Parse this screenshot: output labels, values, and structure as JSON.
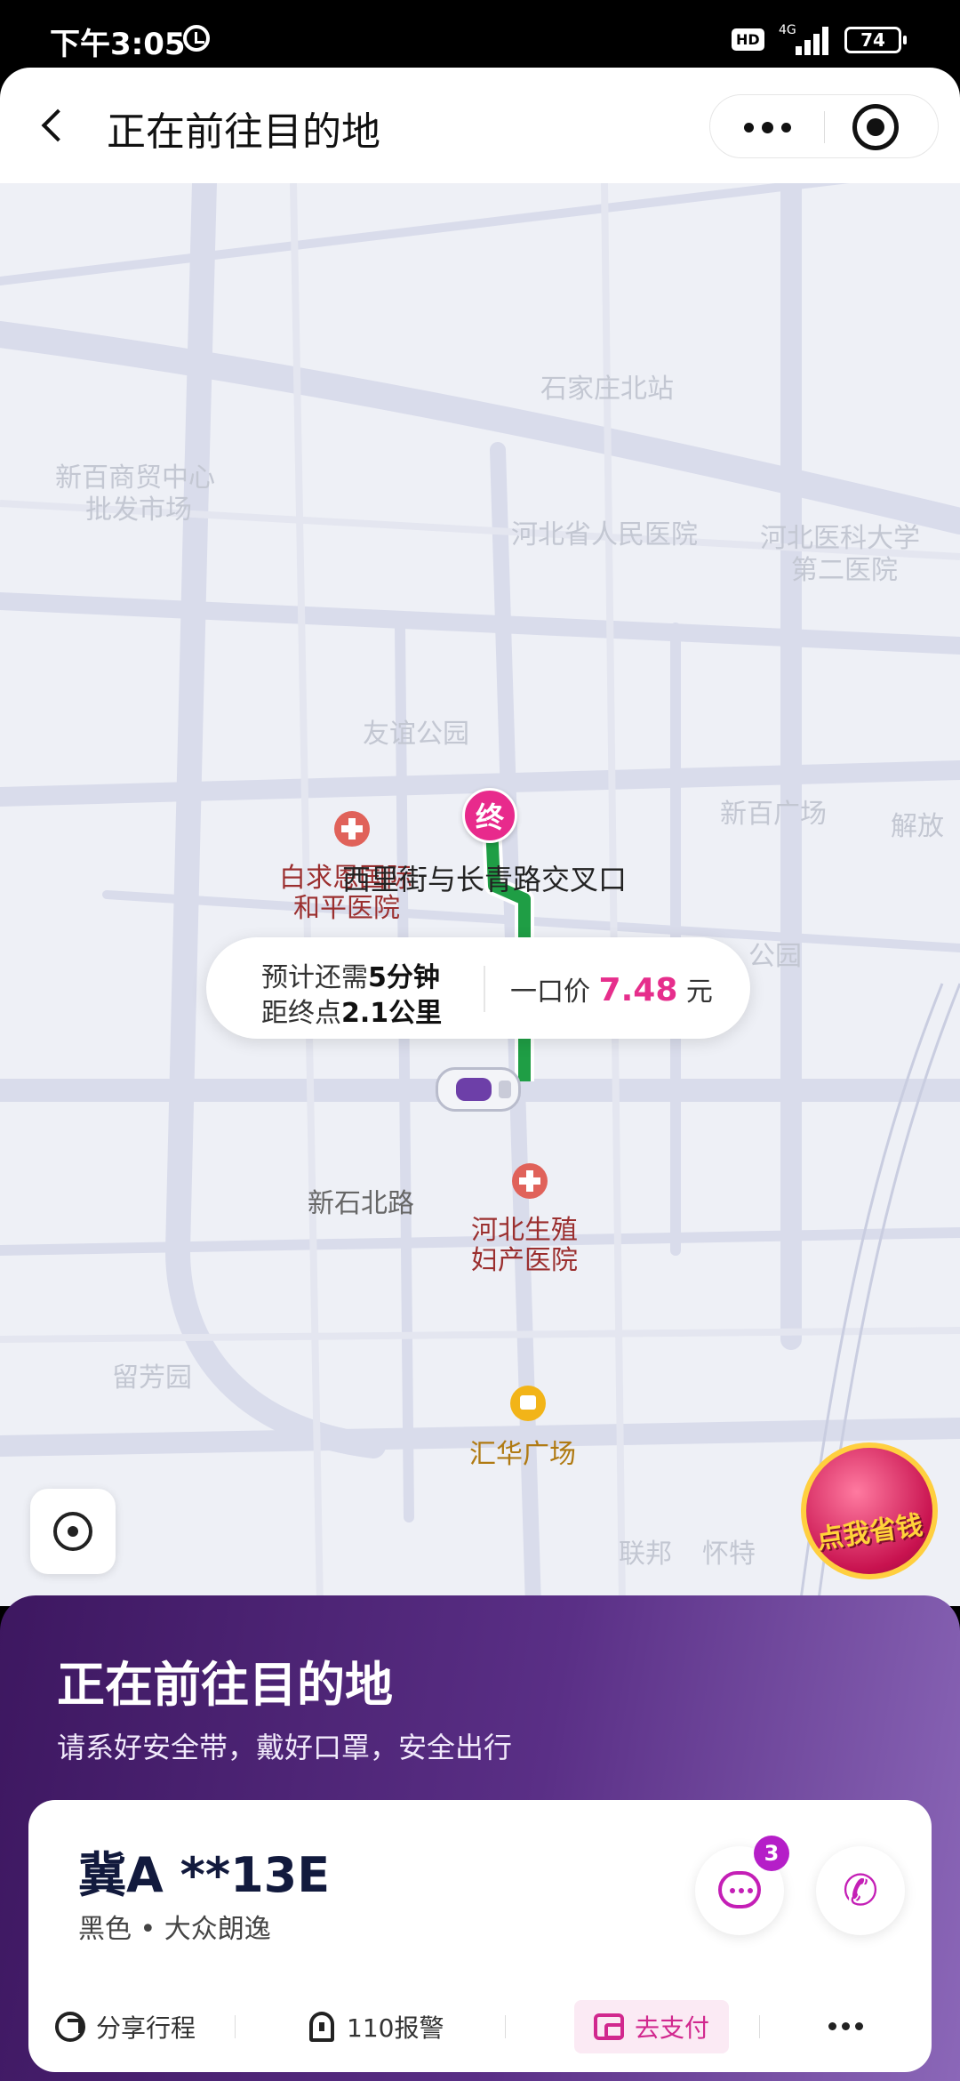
{
  "status_bar": {
    "time": "下午3:05",
    "hd": "HD",
    "network": "4G",
    "battery": "74"
  },
  "header": {
    "title": "正在前往目的地"
  },
  "map": {
    "faded_labels": [
      "石家庄北站",
      "新百商贸中心",
      "批发市场",
      "河北省人民医院",
      "河北医科大学",
      "第二医院",
      "友谊公园",
      "新百广场",
      "解放",
      "公园",
      "留芳园",
      "联邦",
      "怀特"
    ],
    "pois": {
      "hospital_1": "白求恩国际",
      "hospital_1_line2": "和平医院",
      "road": "新石北路",
      "hospital_2": "河北生殖",
      "hospital_2_line2": "妇产医院",
      "mall": "汇华广场"
    },
    "end_marker": "终",
    "destination": "西里街与长青路交叉口",
    "route_color": "#1f9e45",
    "eta": {
      "remain_prefix": "预计还需",
      "remain_time": "5分钟",
      "distance_prefix": "距终点",
      "distance": "2.1公里",
      "price_prefix": "一口价",
      "price": "7.48",
      "price_unit": "元"
    },
    "promo": "点我省钱"
  },
  "panel": {
    "title": "正在前往目的地",
    "subtitle": "请系好安全带，戴好口罩，安全出行",
    "plate": "冀A **13E",
    "car_desc": "黑色 • 大众朗逸",
    "unread_count": "3",
    "actions": {
      "share": "分享行程",
      "alarm": "110报警",
      "pay": "去支付"
    },
    "accent_color": "#c41fb6"
  }
}
